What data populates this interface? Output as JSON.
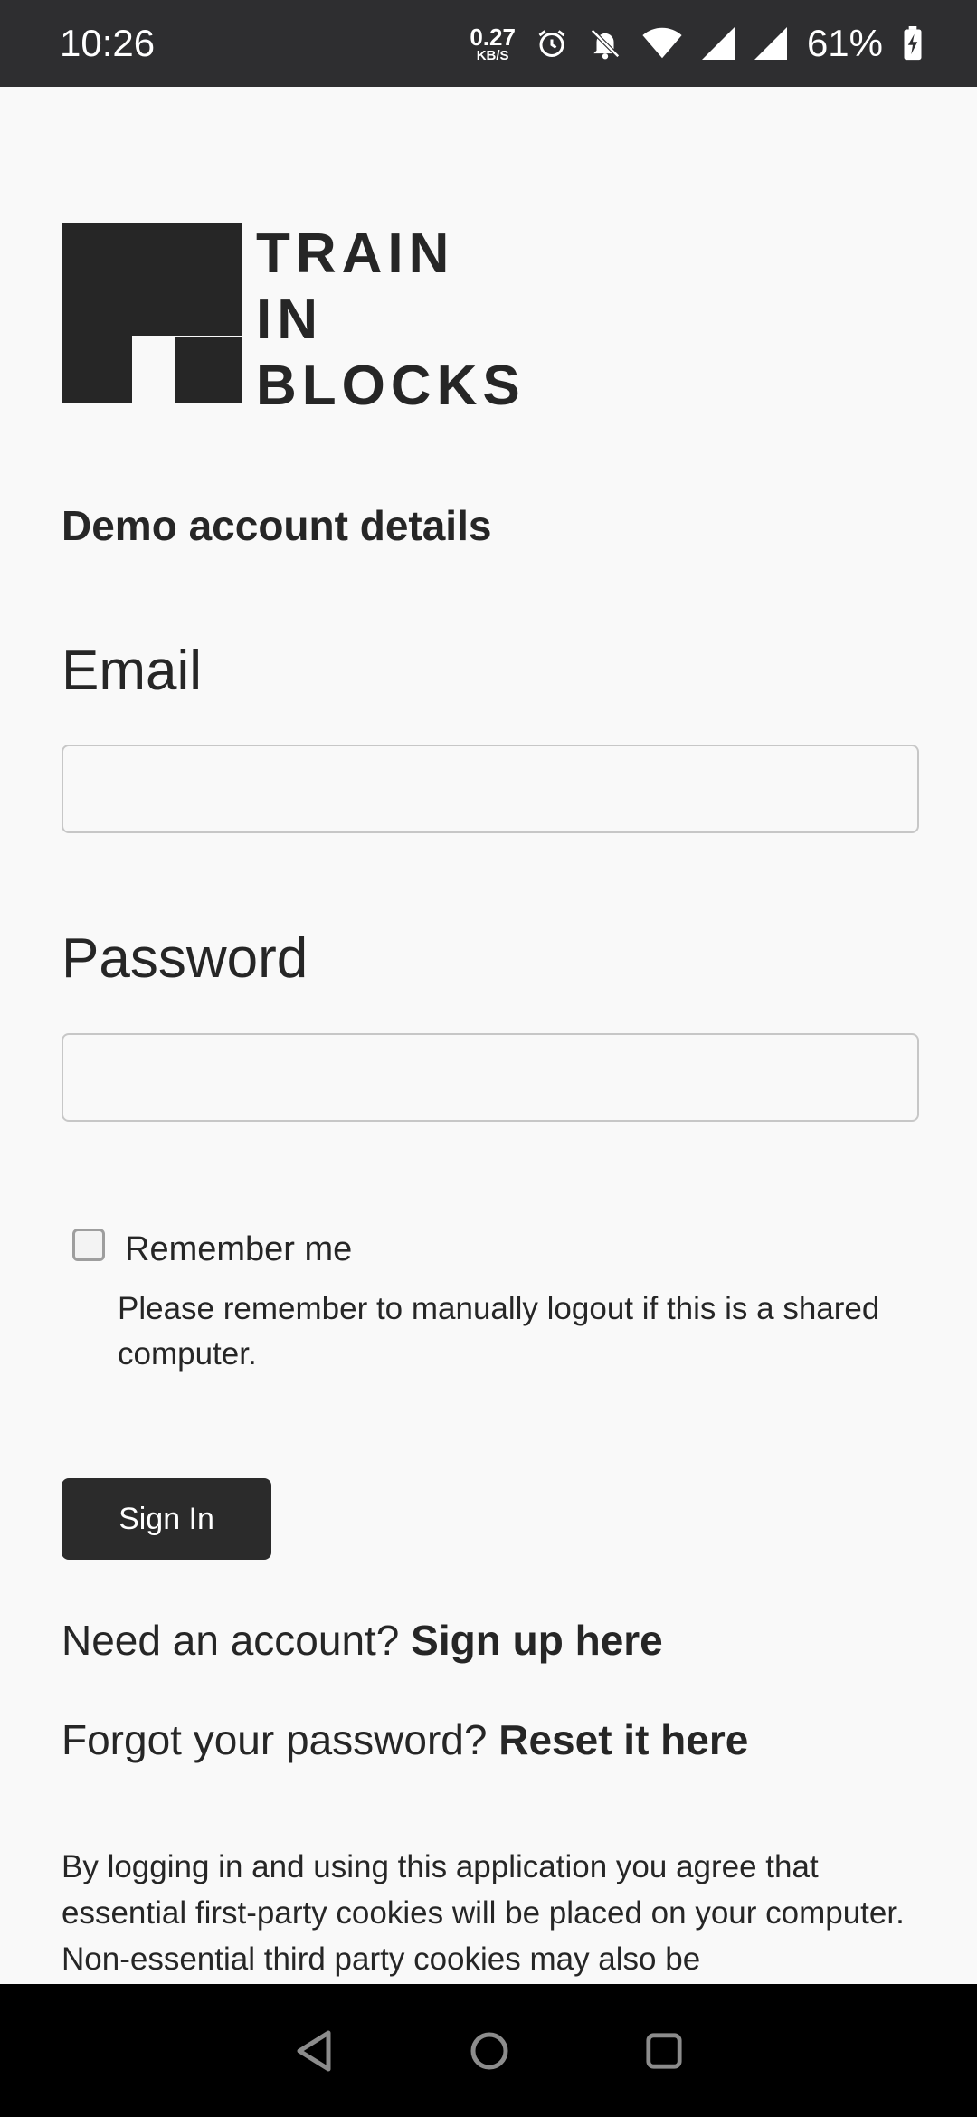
{
  "status_bar": {
    "time": "10:26",
    "net_speed_value": "0.27",
    "net_speed_unit": "KB/S",
    "battery_percent": "61%"
  },
  "logo": {
    "line1": "TRAIN",
    "line2": "IN",
    "line3": "BLOCKS"
  },
  "demo_link": "Demo account details",
  "email": {
    "label": "Email",
    "value": "",
    "placeholder": ""
  },
  "password": {
    "label": "Password",
    "value": "",
    "placeholder": ""
  },
  "remember": {
    "label": "Remember me",
    "checked": false,
    "note": "Please remember to manually logout if this is a shared computer."
  },
  "sign_in_button": "Sign In",
  "signup": {
    "prompt": "Need an account?",
    "link": "Sign up here"
  },
  "reset": {
    "prompt": "Forgot your password?",
    "link": "Reset it here"
  },
  "cookie_notice": "By logging in and using this application you agree that essential first-party cookies will be placed on your computer. Non-essential third party cookies may also be",
  "colors": {
    "status_bar_bg": "#2e2e30",
    "page_bg": "#f9f9f9",
    "button_bg": "#2b2b2b",
    "nav_bar_bg": "#000000"
  },
  "icons": {
    "status": [
      "alarm-icon",
      "notifications-off-icon",
      "wifi-icon",
      "signal-icon",
      "signal-icon",
      "battery-charging-icon"
    ],
    "nav": [
      "back-icon",
      "home-icon",
      "recents-icon"
    ]
  }
}
